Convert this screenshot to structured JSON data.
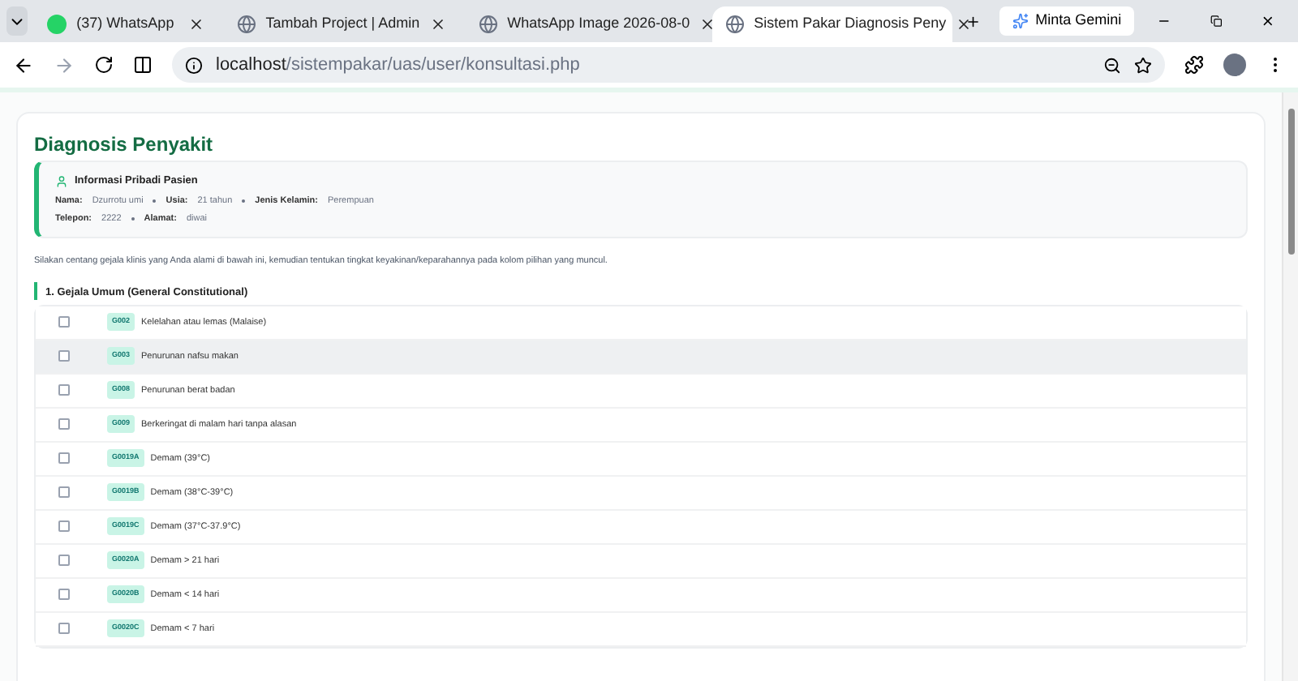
{
  "browser": {
    "tabs": [
      {
        "title": "(37) WhatsApp",
        "kind": "chat",
        "selected": false
      },
      {
        "title": "Tambah Project | Admin",
        "kind": "web",
        "selected": false
      },
      {
        "title": "WhatsApp Image 2026-08-0",
        "kind": "web",
        "selected": false
      },
      {
        "title": "Sistem Pakar Diagnosis Peny",
        "kind": "web",
        "selected": true
      }
    ],
    "gemini_button": "Minta Gemini",
    "url": {
      "host": "localhost",
      "path": "/sistempakar/uas/user/konsultasi.php"
    }
  },
  "page": {
    "title": "Diagnosis Penyakit",
    "patient": {
      "heading": "Informasi Pribadi Pasien",
      "lines": [
        [
          {
            "label": "Nama:",
            "value": "Dzurrotu umi"
          },
          {
            "label": "Usia:",
            "value": "21 tahun"
          },
          {
            "label": "Jenis Kelamin:",
            "value": "Perempuan"
          }
        ],
        [
          {
            "label": "Telepon:",
            "value": "2222"
          },
          {
            "label": "Alamat:",
            "value": "diwai"
          }
        ]
      ]
    },
    "instruction": "Silakan centang gejala klinis yang Anda alami di bawah ini, kemudian tentukan tingkat keyakinan/keparahannya pada kolom pilihan yang muncul.",
    "section": {
      "title": "1. Gejala Umum (General Constitutional)",
      "symptoms": [
        {
          "code": "G002",
          "name": "Kelelahan atau lemas (Malaise)",
          "checked": false,
          "hovered": false
        },
        {
          "code": "G003",
          "name": "Penurunan nafsu makan",
          "checked": false,
          "hovered": true
        },
        {
          "code": "G008",
          "name": "Penurunan berat badan",
          "checked": false,
          "hovered": false
        },
        {
          "code": "G009",
          "name": "Berkeringat di malam hari tanpa alasan",
          "checked": false,
          "hovered": false
        },
        {
          "code": "G0019A",
          "name": "Demam (39°C)",
          "checked": false,
          "hovered": false
        },
        {
          "code": "G0019B",
          "name": "Demam (38°C-39°C)",
          "checked": false,
          "hovered": false
        },
        {
          "code": "G0019C",
          "name": "Demam (37°C-37.9°C)",
          "checked": false,
          "hovered": false
        },
        {
          "code": "G0020A",
          "name": "Demam > 21 hari",
          "checked": false,
          "hovered": false
        },
        {
          "code": "G0020B",
          "name": "Demam < 14 hari",
          "checked": false,
          "hovered": false
        },
        {
          "code": "G0020C",
          "name": "Demam < 7 hari",
          "checked": false,
          "hovered": false
        }
      ]
    }
  }
}
